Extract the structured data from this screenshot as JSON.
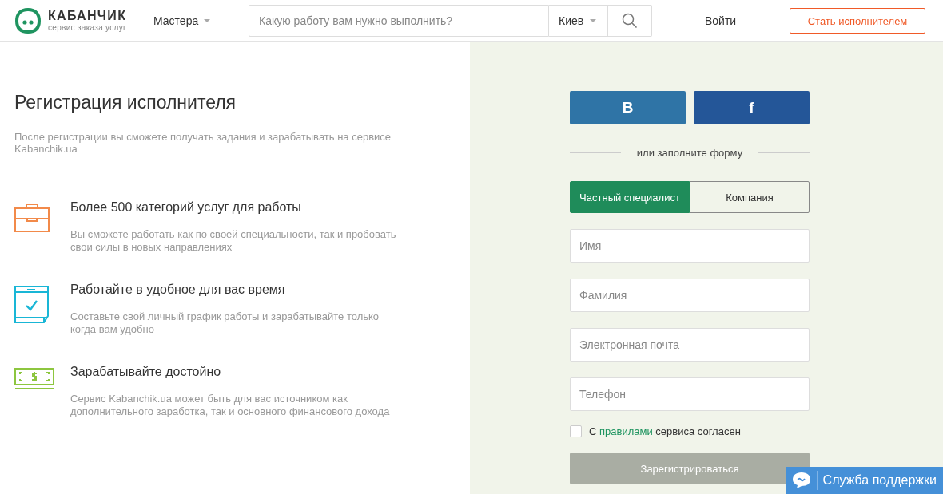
{
  "header": {
    "logo": {
      "name": "КАБАНЧИК",
      "tagline": "сервис заказа услуг"
    },
    "menu": "Мастера",
    "search": {
      "placeholder": "Какую работу вам нужно выполнить?"
    },
    "city": "Киев",
    "login": "Войти",
    "cta": "Стать исполнителем"
  },
  "intro": {
    "title": "Регистрация исполнителя",
    "subtitle": "После регистрации вы сможете получать задания и зарабатывать на сервисе Kabanchik.ua"
  },
  "features": [
    {
      "kind": "briefcase",
      "title": "Более 500 категорий услуг для работы",
      "text": "Вы сможете работать как по своей специальности, так и пробовать свои силы в новых направлениях"
    },
    {
      "kind": "calendar",
      "title": "Работайте в удобное для вас время",
      "text": "Составьте свой личный график работы и зарабатывайте только когда вам удобно"
    },
    {
      "kind": "money",
      "title": "Зарабатывайте достойно",
      "text": "Сервис Kabanchik.ua может быть для вас источником как дополнительного заработка, так и основного финансового дохода"
    }
  ],
  "form": {
    "social": [
      {
        "kind": "vk",
        "label": "В"
      },
      {
        "kind": "fb",
        "label": "f"
      }
    ],
    "divider": "или заполните форму",
    "tabs": [
      {
        "label": "Частный специалист",
        "selected": true
      },
      {
        "label": "Компания",
        "selected": false
      }
    ],
    "fields": [
      {
        "placeholder": "Имя"
      },
      {
        "placeholder": "Фамилия"
      },
      {
        "placeholder": "Электронная почта"
      },
      {
        "placeholder": "Телефон"
      }
    ],
    "agree": {
      "checked": false,
      "before": "С",
      "link": "правилами",
      "after": "сервиса согласен"
    },
    "submit": {
      "label": "Зарегистрироваться",
      "disabled": true
    }
  },
  "support": "Служба поддержки"
}
